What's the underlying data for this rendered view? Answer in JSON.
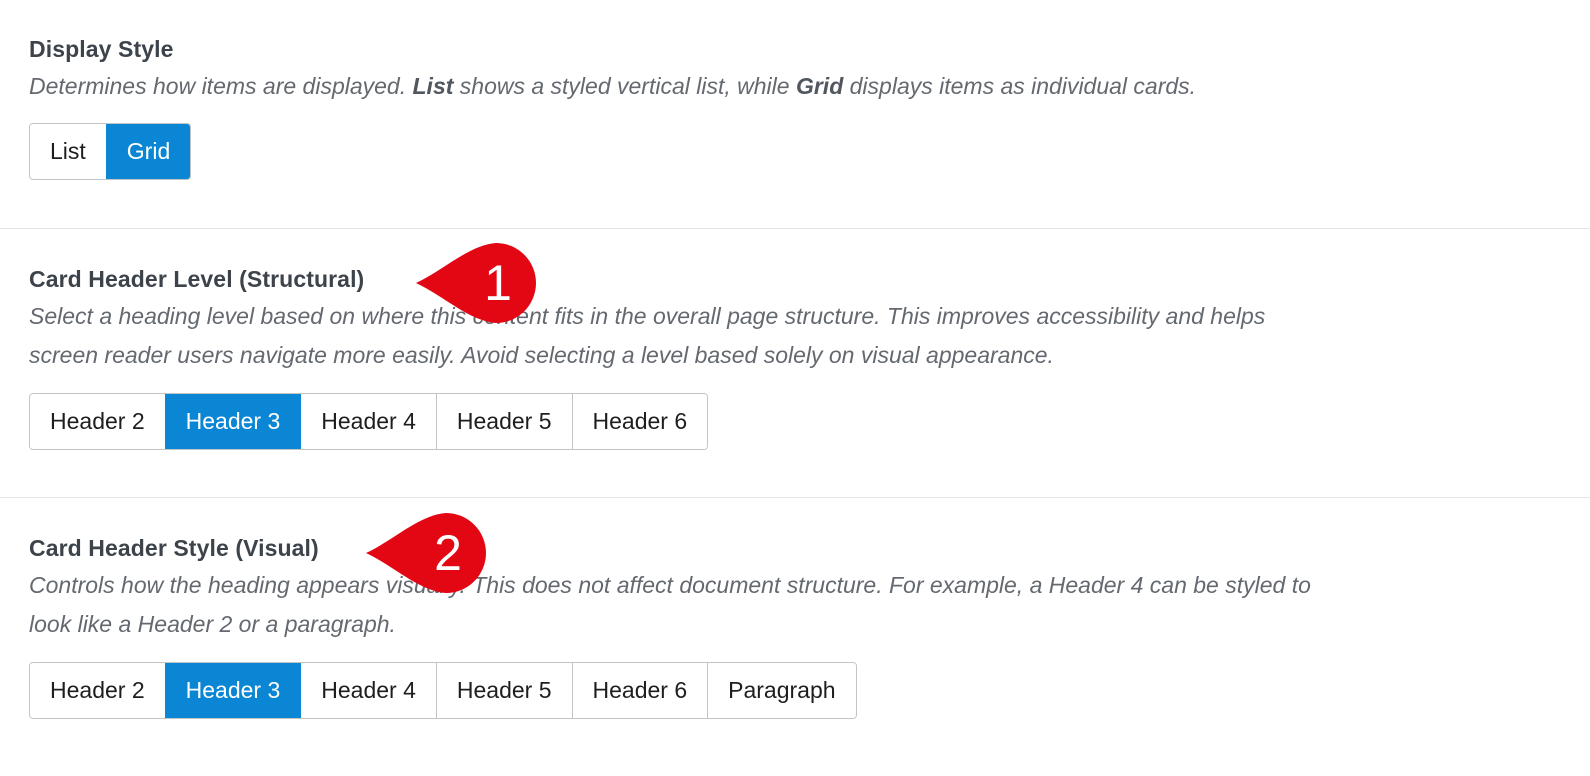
{
  "display_style": {
    "title": "Display Style",
    "desc_part1": "Determines how items are displayed. ",
    "desc_bold1": "List",
    "desc_part2": " shows a styled vertical list, while ",
    "desc_bold2": "Grid",
    "desc_part3": " displays items as individual cards.",
    "options": [
      "List",
      "Grid"
    ],
    "selected": "Grid"
  },
  "header_level": {
    "title": "Card Header Level (Structural)",
    "desc_line1": "Select a heading level based on where this content fits in the overall page structure. This improves accessibility and helps",
    "desc_line2": "screen reader users navigate more easily. Avoid selecting a level based solely on visual appearance.",
    "options": [
      "Header 2",
      "Header 3",
      "Header 4",
      "Header 5",
      "Header 6"
    ],
    "selected": "Header 3"
  },
  "header_style": {
    "title": "Card Header Style (Visual)",
    "desc_line1": "Controls how the heading appears visually. This does not affect document structure. For example, a Header 4 can be styled to",
    "desc_line2": "look like a Header 2 or a paragraph.",
    "options": [
      "Header 2",
      "Header 3",
      "Header 4",
      "Header 5",
      "Header 6",
      "Paragraph"
    ],
    "selected": "Header 3"
  },
  "callouts": [
    "1",
    "2"
  ],
  "colors": {
    "accent": "#0a86d4",
    "callout": "#e30613"
  }
}
